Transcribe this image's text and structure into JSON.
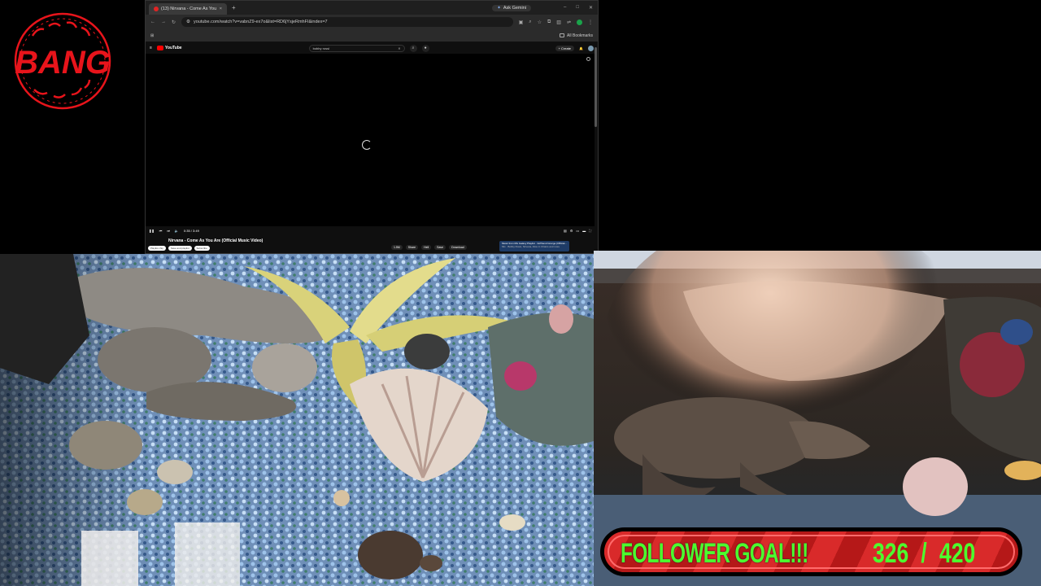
{
  "overlay": {
    "logo_text": "BANG",
    "logo_color": "#e8141b"
  },
  "browser": {
    "tab_title": "(13) Nirvana - Come As You Ar...",
    "ask_gemini": "Ask Gemini",
    "url": "youtube.com/watch?v=vabnZ9-ex7o&list=RD6jYsjeRmhFI&index=7",
    "all_bookmarks": "All Bookmarks"
  },
  "youtube": {
    "logo": "YouTube",
    "search_value": "bobby rossi",
    "create_label": "+ Create",
    "video_title": "Nirvana - Come As You Are (Official Music Video)",
    "time": "0:35 / 3:49",
    "chips": [
      "Playlist chip",
      "Save and playlist",
      "Subscribe"
    ],
    "actions": [
      "1.5M",
      "Share",
      "Hell",
      "Save",
      "Download"
    ],
    "playlist_title": "Music from Mix Galaxy Playlist · Girlfriend Grunge (Official...",
    "playlist_sub": "Mix · Bobby Rossi, Nirvana, Alice in Chains and more"
  },
  "follower_goal": {
    "label": "FOLLOWER GOAL!!!",
    "current": "326",
    "separator": "/",
    "target": "420",
    "progress": 0.776
  },
  "colors": {
    "goal_bg": "#c42020",
    "goal_text": "#4cff2e"
  }
}
